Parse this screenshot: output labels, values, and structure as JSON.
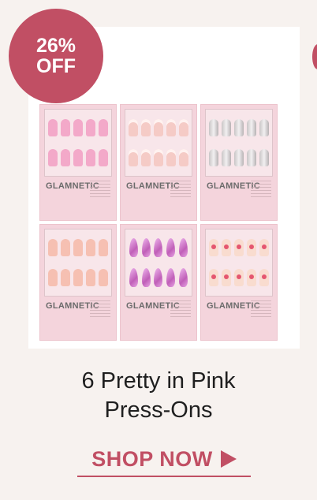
{
  "badge": {
    "percent": "26%",
    "off": "OFF"
  },
  "product": {
    "title_line1": "6 Pretty in Pink",
    "title_line2": "Press-Ons"
  },
  "cta": {
    "label": "SHOP NOW"
  },
  "brand": "GLAMNETIC",
  "colors": {
    "accent": "#c14f64",
    "background": "#f7f2ef"
  }
}
